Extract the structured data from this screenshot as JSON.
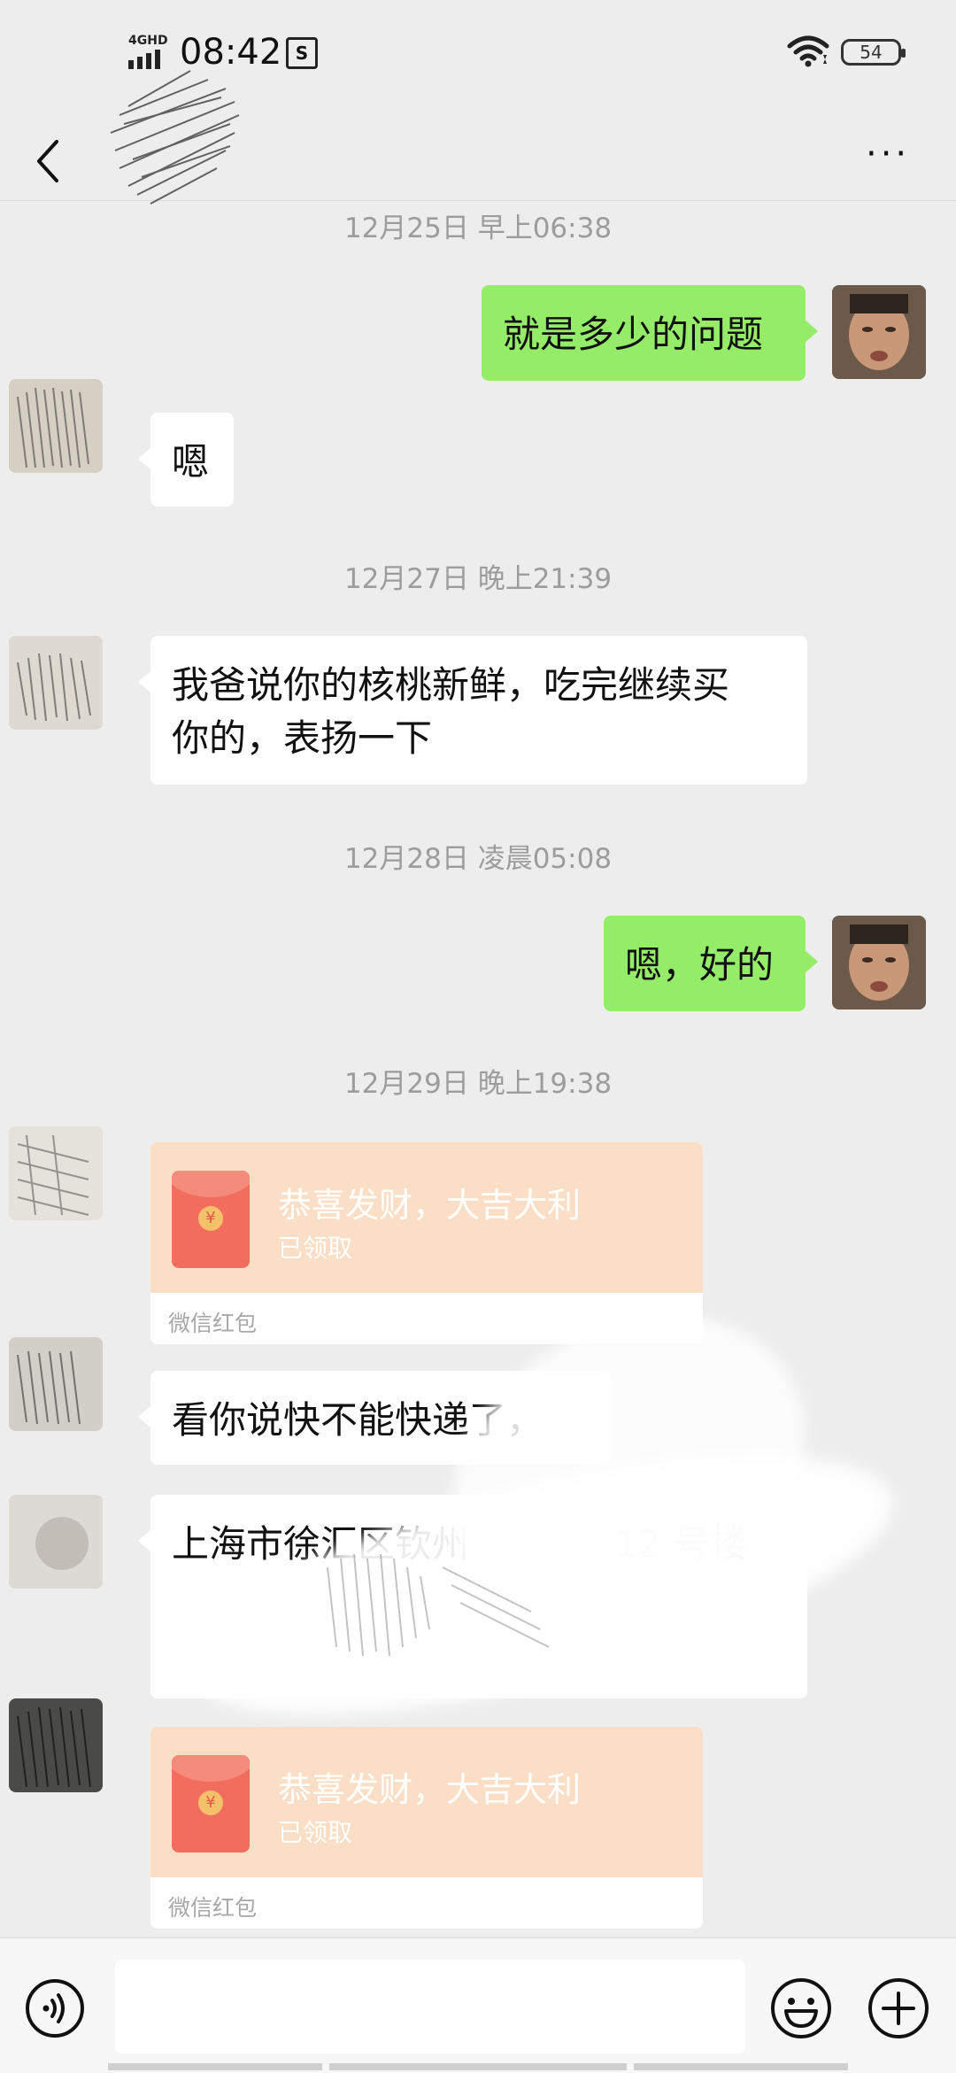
{
  "status_bar": {
    "network": "4GHD",
    "time": "08:42",
    "sim_icon": "S",
    "battery": "54"
  },
  "nav": {
    "back_icon": "chevron-left-icon",
    "more_icon": "more-dots-icon",
    "more": "···"
  },
  "messages": {
    "ts1": "12月25日 早上06:38",
    "m1": "就是多少的问题",
    "m2": "嗯",
    "ts2": "12月27日 晚上21:39",
    "m3_line1": "我爸说你的核桃新鲜，吃完继续买",
    "m3_line2": "你的，表扬一下",
    "ts3": "12月28日 凌晨05:08",
    "m4": "嗯，好的",
    "ts4": "12月29日 晚上19:38",
    "rp1": {
      "title": "恭喜发财，大吉大利",
      "status": "已领取",
      "label": "微信红包"
    },
    "m5": "看你说快不能快递了，",
    "m6_line1": "上海市徐汇区钦州",
    "m6_line1b": "12 号楼",
    "rp2": {
      "title": "恭喜发财，大吉大利",
      "status": "已领取",
      "label": "微信红包"
    }
  },
  "input_bar": {
    "voice_icon": "voice-icon",
    "emoji_icon": "emoji-icon",
    "plus_icon": "plus-icon"
  },
  "colors": {
    "my_bubble": "#95ec69",
    "peer_bubble": "#ffffff",
    "red_packet": "#fadfc6",
    "background": "#ededed"
  }
}
